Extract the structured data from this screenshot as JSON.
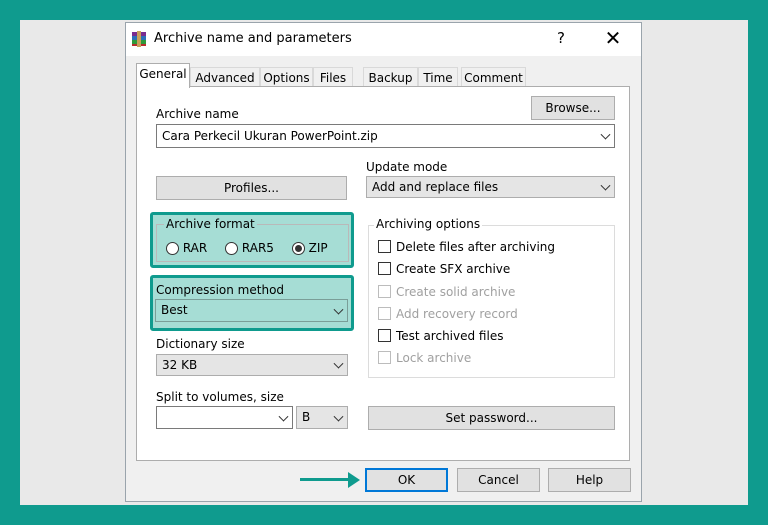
{
  "window": {
    "title": "Archive name and parameters",
    "help": "?",
    "close": "✕"
  },
  "tabs": [
    "General",
    "Advanced",
    "Options",
    "Files",
    "Backup",
    "Time",
    "Comment"
  ],
  "general": {
    "archive_name_label": "Archive name",
    "browse_label": "Browse...",
    "archive_name_value": "Cara Perkecil Ukuran PowerPoint.zip",
    "update_mode_label": "Update mode",
    "update_mode_value": "Add and replace files",
    "profiles_label": "Profiles...",
    "archive_format": {
      "legend": "Archive format",
      "options": [
        "RAR",
        "RAR5",
        "ZIP"
      ],
      "selected": "ZIP"
    },
    "compression_method": {
      "label": "Compression method",
      "value": "Best"
    },
    "dictionary_size": {
      "label": "Dictionary size",
      "value": "32 KB"
    },
    "split": {
      "label": "Split to volumes, size",
      "value": "",
      "unit": "B"
    },
    "archiving_options": {
      "legend": "Archiving options",
      "items": [
        {
          "label": "Delete files after archiving",
          "checked": false,
          "enabled": true
        },
        {
          "label": "Create SFX archive",
          "checked": false,
          "enabled": true
        },
        {
          "label": "Create solid archive",
          "checked": false,
          "enabled": false
        },
        {
          "label": "Add recovery record",
          "checked": false,
          "enabled": false
        },
        {
          "label": "Test archived files",
          "checked": false,
          "enabled": true
        },
        {
          "label": "Lock archive",
          "checked": false,
          "enabled": false
        }
      ]
    },
    "set_password_label": "Set password..."
  },
  "footer": {
    "ok": "OK",
    "cancel": "Cancel",
    "help": "Help"
  },
  "colors": {
    "accent": "#0f9b8e",
    "highlight": "#a6ddd5"
  }
}
